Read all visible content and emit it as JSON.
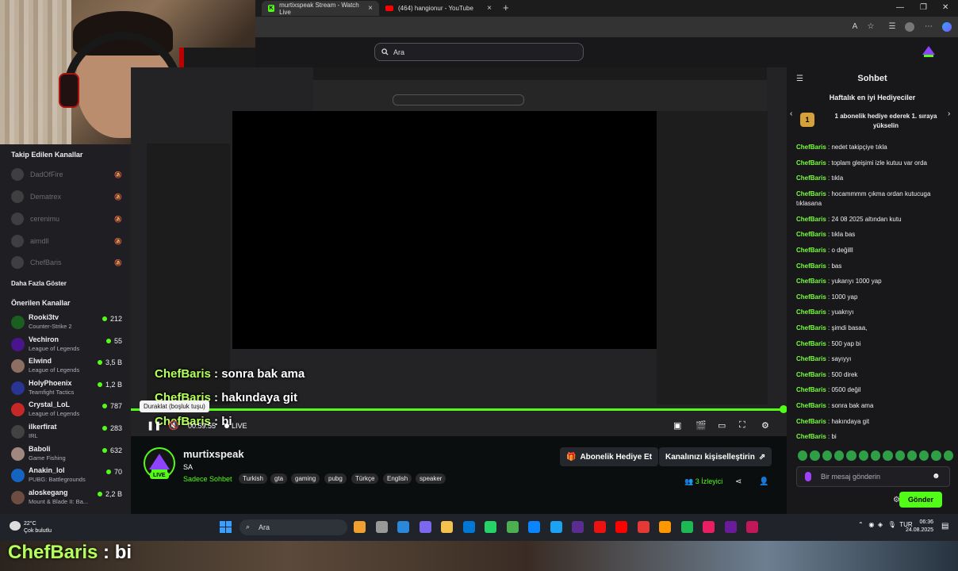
{
  "browser": {
    "tabs": [
      {
        "label": "murtixspeak Stream - Watch Live"
      },
      {
        "label": "(464) hangionur - YouTube"
      }
    ],
    "new_tab": "+"
  },
  "header": {
    "search_placeholder": "Ara"
  },
  "sidebar": {
    "followed_title": "Takip Edilen Kanallar",
    "followed": [
      {
        "name": "DadOfFire"
      },
      {
        "name": "Dematrex"
      },
      {
        "name": "cerenimu"
      },
      {
        "name": "aimdll"
      },
      {
        "name": "ChefBaris"
      }
    ],
    "show_more": "Daha Fazla Göster",
    "recommended_title": "Önerilen Kanallar",
    "recommended": [
      {
        "name": "Rooki3tv",
        "game": "Counter-Strike 2",
        "viewers": "212",
        "color": "#1b5e20"
      },
      {
        "name": "Vechiron",
        "game": "League of Legends",
        "viewers": "55",
        "color": "#4a148c"
      },
      {
        "name": "Elwind",
        "game": "League of Legends",
        "viewers": "3,5 B",
        "color": "#8d6e63"
      },
      {
        "name": "HolyPhoenix",
        "game": "Teamfight Tactics",
        "viewers": "1,2 B",
        "color": "#283593"
      },
      {
        "name": "Crystal_LoL",
        "game": "League of Legends",
        "viewers": "787",
        "color": "#c62828"
      },
      {
        "name": "ilkerfirat",
        "game": "IRL",
        "viewers": "283",
        "color": "#424242"
      },
      {
        "name": "Baboli",
        "game": "Game Fishing",
        "viewers": "632",
        "color": "#a1887f"
      },
      {
        "name": "Anakin_lol",
        "game": "PUBG: Battlegrounds",
        "viewers": "70",
        "color": "#1565c0"
      },
      {
        "name": "aloskegang",
        "game": "Mount & Blade II: Ba...",
        "viewers": "2,2 B",
        "color": "#6d4c41"
      }
    ]
  },
  "video": {
    "overlay_chat": [
      {
        "user": "ChefBaris",
        "text": " : sonra bak ama"
      },
      {
        "user": "ChefBaris",
        "text": " : hakındaya git"
      },
      {
        "user": "ChefBaris",
        "text": " : bi"
      }
    ],
    "progress": 0.995
  },
  "player": {
    "tooltip": "Duraklat (boşluk tuşu)",
    "time": "00:59:55",
    "live_label": "LIVE"
  },
  "channel": {
    "name": "murtixspeak",
    "title": "SA",
    "live_badge": "LIVE",
    "category": "Sadece Sohbet",
    "tags": [
      "Turkish",
      "gta",
      "gaming",
      "pubg",
      "Türkçe",
      "English",
      "speaker"
    ],
    "gift_button": "Abonelik Hediye Et",
    "customize_button": "Kanalınızı kişiselleştirin",
    "viewers": "3",
    "viewers_label": "İzleyici"
  },
  "chat": {
    "title": "Sohbet",
    "gifter_title": "Haftalık en iyi Hediyeciler",
    "gifter_rank": "1",
    "gifter_text": "1 abonelik hediye ederek 1. sıraya yükselin",
    "messages": [
      {
        "user": "ChefBaris",
        "text": ": nedet takipçiye tıkla"
      },
      {
        "user": "ChefBaris",
        "text": ": toplam gleişimi izle kutuu var orda"
      },
      {
        "user": "ChefBaris",
        "text": ": tıkla"
      },
      {
        "user": "ChefBaris",
        "text": ": hocammmm çıkma ordan kutucuga tıklasana"
      },
      {
        "user": "ChefBaris",
        "text": ": 24 08 2025 altından kutu"
      },
      {
        "user": "ChefBaris",
        "text": ": tıkla bas"
      },
      {
        "user": "ChefBaris",
        "text": ": o değilll"
      },
      {
        "user": "ChefBaris",
        "text": ": bas"
      },
      {
        "user": "ChefBaris",
        "text": ": yukarıyı 1000 yap"
      },
      {
        "user": "ChefBaris",
        "text": ": 1000 yap"
      },
      {
        "user": "ChefBaris",
        "text": ": yuakrıyı"
      },
      {
        "user": "ChefBaris",
        "text": ": şimdi basaa,"
      },
      {
        "user": "ChefBaris",
        "text": ": 500 yap bi"
      },
      {
        "user": "ChefBaris",
        "text": ": sayıyyı"
      },
      {
        "user": "ChefBaris",
        "text": ": 500 direk"
      },
      {
        "user": "ChefBaris",
        "text": ": 0500 değil"
      },
      {
        "user": "ChefBaris",
        "text": ": sonra bak ama"
      },
      {
        "user": "ChefBaris",
        "text": ": hakındaya git"
      },
      {
        "user": "ChefBaris",
        "text": ": bi"
      }
    ],
    "input_placeholder": "Bir mesaj gönderin",
    "send_label": "Gönder"
  },
  "taskbar": {
    "weather_temp": "22°C",
    "weather_desc": "Çok bulutlu",
    "search": "Ara",
    "lang": "TUR",
    "time": "06:36",
    "date": "24.08.2025"
  },
  "bottom_overlay": {
    "user": "ChefBaris",
    "text": " : bi"
  },
  "colors": {
    "accent": "#53fc18",
    "background": "#0b0e0f",
    "panel": "#18181b"
  }
}
